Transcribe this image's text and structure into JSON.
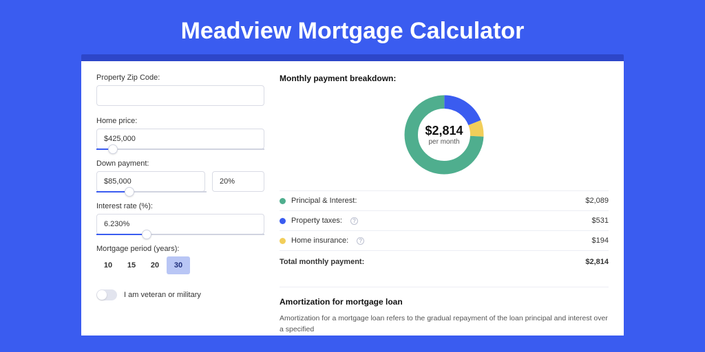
{
  "title": "Meadview Mortgage Calculator",
  "colors": {
    "accent": "#3a5cf0",
    "principal": "#4fae8e",
    "taxes": "#3a5cf0",
    "insurance": "#f2ce5a"
  },
  "form": {
    "zip_label": "Property Zip Code:",
    "zip_value": "",
    "home_price_label": "Home price:",
    "home_price_value": "$425,000",
    "down_payment_label": "Down payment:",
    "down_payment_amount": "$85,000",
    "down_payment_pct": "20%",
    "interest_label": "Interest rate (%):",
    "interest_value": "6.230%",
    "period_label": "Mortgage period (years):",
    "period_options": [
      "10",
      "15",
      "20",
      "30"
    ],
    "period_selected": "30",
    "veteran_label": "I am veteran or military"
  },
  "breakdown": {
    "title": "Monthly payment breakdown:",
    "center_value": "$2,814",
    "center_sub": "per month",
    "rows": [
      {
        "label": "Principal & Interest:",
        "value": "$2,089",
        "colorKey": "principal",
        "help": false
      },
      {
        "label": "Property taxes:",
        "value": "$531",
        "colorKey": "taxes",
        "help": true
      },
      {
        "label": "Home insurance:",
        "value": "$194",
        "colorKey": "insurance",
        "help": true
      }
    ],
    "total_label": "Total monthly payment:",
    "total_value": "$2,814"
  },
  "amortization": {
    "title": "Amortization for mortgage loan",
    "text": "Amortization for a mortgage loan refers to the gradual repayment of the loan principal and interest over a specified"
  },
  "chart_data": {
    "type": "pie",
    "title": "Monthly payment breakdown",
    "series": [
      {
        "name": "Principal & Interest",
        "value": 2089,
        "color": "#4fae8e"
      },
      {
        "name": "Property taxes",
        "value": 531,
        "color": "#3a5cf0"
      },
      {
        "name": "Home insurance",
        "value": 194,
        "color": "#f2ce5a"
      }
    ],
    "total": 2814,
    "center_label": "$2,814 per month"
  }
}
